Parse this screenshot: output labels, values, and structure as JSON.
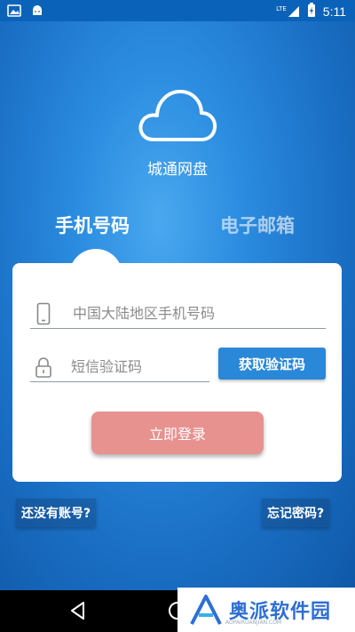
{
  "status_bar": {
    "time": "5:11",
    "network_label": "LTE"
  },
  "app": {
    "name": "城通网盘"
  },
  "tabs": [
    {
      "label": "手机号码",
      "active": true
    },
    {
      "label": "电子邮箱",
      "active": false
    }
  ],
  "form": {
    "phone_placeholder": "中国大陆地区手机号码",
    "code_placeholder": "短信验证码",
    "get_code_label": "获取验证码",
    "login_label": "立即登录"
  },
  "links": {
    "register": "还没有账号?",
    "forgot": "忘记密码?"
  },
  "watermark": {
    "text": "奥派软件园",
    "subtext": "AOPAIRUANJIAN.COM"
  },
  "colors": {
    "primary_blue": "#2a88d9",
    "login_button": "#e7928f",
    "background": "#1a6fc4"
  }
}
